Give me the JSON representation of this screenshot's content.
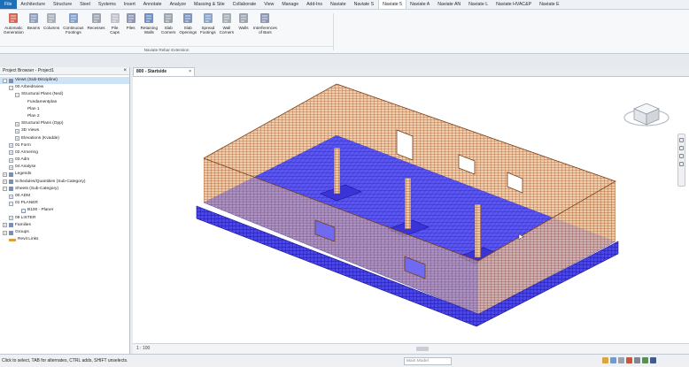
{
  "ribbon": {
    "tabs": [
      "File",
      "Architecture",
      "Structure",
      "Steel",
      "Systems",
      "Insert",
      "Annotate",
      "Analyze",
      "Massing & Site",
      "Collaborate",
      "View",
      "Manage",
      "Add-Ins",
      "Naviate",
      "Naviate S",
      "Naviate 5",
      "Naviate A",
      "Naviate AN",
      "Naviate L",
      "Naviate HVAC&P",
      "Naviate E"
    ],
    "active_tab_index": 15,
    "tools": [
      {
        "label": "Automatic\nGeneration",
        "icon": "auto-generation-icon"
      },
      {
        "label": "Beams",
        "icon": "beams-icon"
      },
      {
        "label": "Columns",
        "icon": "columns-icon"
      },
      {
        "label": "Continuous\nFootings",
        "icon": "continuous-footings-icon"
      },
      {
        "label": "Recesses",
        "icon": "recesses-icon"
      },
      {
        "label": "Pile\nCaps",
        "icon": "pile-caps-icon"
      },
      {
        "label": "Piles",
        "icon": "piles-icon"
      },
      {
        "label": "Retaining\nWalls",
        "icon": "retaining-walls-icon"
      },
      {
        "label": "Slab\nCorners",
        "icon": "slab-corners-icon"
      },
      {
        "label": "Slab\nOpenings",
        "icon": "slab-openings-icon"
      },
      {
        "label": "Spread\nFootings",
        "icon": "spread-footings-icon"
      },
      {
        "label": "Wall\nCorners",
        "icon": "wall-corners-icon"
      },
      {
        "label": "Walls",
        "icon": "walls-icon"
      },
      {
        "label": "Interferences\nof Bars",
        "icon": "interferences-icon"
      }
    ],
    "panel_caption": "Naviate Rebar Extension"
  },
  "project_browser": {
    "title": "Project Browser - Project1",
    "close": "×",
    "nodes": [
      {
        "label": "Views (Sub-Discipline)",
        "depth": 0,
        "toggle": "−",
        "icon": "folder",
        "selected": true
      },
      {
        "label": "00 Arbeidsview",
        "depth": 1,
        "toggle": "−",
        "icon": "none"
      },
      {
        "label": "Structural Plans (Ned)",
        "depth": 2,
        "toggle": "−",
        "icon": "none"
      },
      {
        "label": "Fundamentplan",
        "depth": 3,
        "toggle": "",
        "icon": "none"
      },
      {
        "label": "Plan 1",
        "depth": 3,
        "toggle": "",
        "icon": "none"
      },
      {
        "label": "Plan 2",
        "depth": 3,
        "toggle": "",
        "icon": "none"
      },
      {
        "label": "Structural Plans (Opp)",
        "depth": 2,
        "toggle": "+",
        "icon": "none"
      },
      {
        "label": "3D Views",
        "depth": 2,
        "toggle": "+",
        "icon": "none"
      },
      {
        "label": "Elevations (Kvadde)",
        "depth": 2,
        "toggle": "+",
        "icon": "none"
      },
      {
        "label": "01 Form",
        "depth": 1,
        "toggle": "+",
        "icon": "none"
      },
      {
        "label": "02 Armering",
        "depth": 1,
        "toggle": "+",
        "icon": "none"
      },
      {
        "label": "03 Adm",
        "depth": 1,
        "toggle": "+",
        "icon": "none"
      },
      {
        "label": "04 Analyse",
        "depth": 1,
        "toggle": "+",
        "icon": "none"
      },
      {
        "label": "Legends",
        "depth": 0,
        "toggle": "+",
        "icon": "folder"
      },
      {
        "label": "Schedules/Quantities (Sub-Category)",
        "depth": 0,
        "toggle": "+",
        "icon": "folder"
      },
      {
        "label": "Sheets (Sub-Category)",
        "depth": 0,
        "toggle": "−",
        "icon": "folder"
      },
      {
        "label": "00 ADM",
        "depth": 1,
        "toggle": "+",
        "icon": "none"
      },
      {
        "label": "01 PLANER",
        "depth": 1,
        "toggle": "−",
        "icon": "none"
      },
      {
        "label": "B100 - Planer",
        "depth": 2,
        "toggle": "",
        "icon": "sheet"
      },
      {
        "label": "09 LISTER",
        "depth": 1,
        "toggle": "+",
        "icon": "none"
      },
      {
        "label": "Families",
        "depth": 0,
        "toggle": "+",
        "icon": "folder"
      },
      {
        "label": "Groups",
        "depth": 0,
        "toggle": "+",
        "icon": "folder"
      },
      {
        "label": "Revit Links",
        "depth": 0,
        "toggle": "",
        "icon": "link"
      }
    ]
  },
  "view": {
    "tab_label": "800 - Startside",
    "tab_close": "×",
    "scale_text": "1 : 100"
  },
  "statusbar": {
    "message": "Click to select, TAB for alternates, CTRL adds, SHIFT unselects.",
    "model_field": "Main Model"
  },
  "colors": {
    "accent": "#1d6fb8",
    "rebar_walls": "#b2612a",
    "rebar_slab": "#3b35e6"
  }
}
